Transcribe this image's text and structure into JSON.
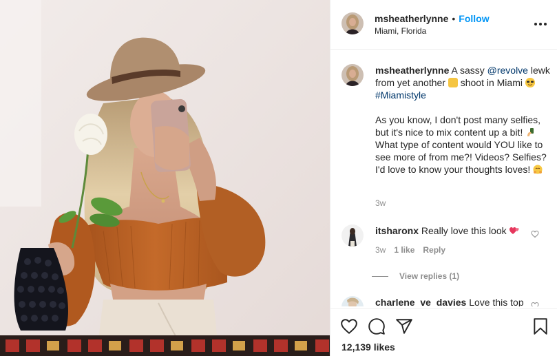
{
  "post": {
    "username": "msheatherlynne",
    "follow_label": "Follow",
    "separator": "•",
    "location": "Miami, Florida"
  },
  "caption": {
    "username": "msheatherlynne",
    "text_before_mention": " A sassy ",
    "mention": "@revolve",
    "text_after_mention": " lewk from yet another ",
    "text_shoot": " shoot in Miami ",
    "hashtag": "#Miamistyle",
    "para2_a": "As you know, I don't post many selfies, but it's nice to mix content up a bit! ",
    "para2_b": " What type of content would YOU like to see more of from me?! Videos? Selfies? I'd love to know your thoughts loves! ",
    "time": "3w"
  },
  "comments": [
    {
      "username": "itsharonx",
      "text": " Really love this look",
      "time": "3w",
      "likes": "1 like",
      "reply_label": "Reply",
      "view_replies": "View replies (1)"
    },
    {
      "username": "charlene_ve_davies",
      "text": " Love this top"
    }
  ],
  "likes_count": "12,139 likes",
  "icons": {
    "heart": "heart-icon",
    "comment": "comment-icon",
    "share": "share-icon",
    "save": "bookmark-icon",
    "more": "more-options-icon"
  },
  "colors": {
    "link": "#0095f6",
    "mention": "#00376b",
    "muted": "#8e8e8e",
    "text": "#262626"
  }
}
